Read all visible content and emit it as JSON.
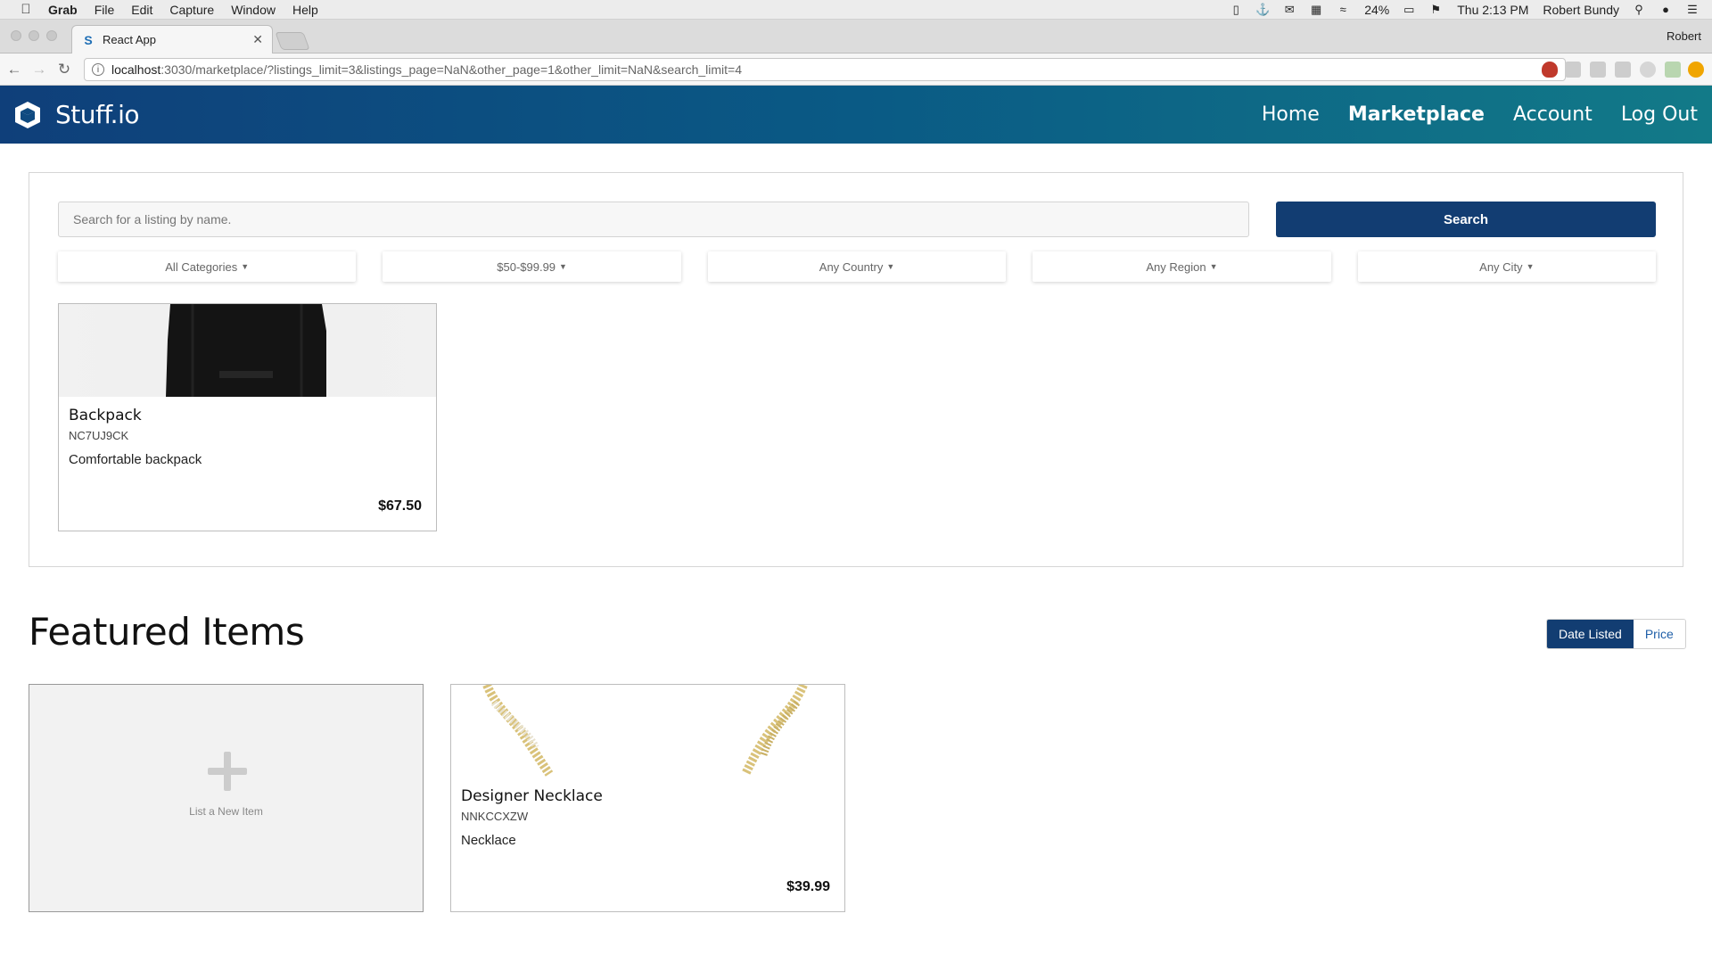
{
  "menubar": {
    "app": "Grab",
    "items": [
      "File",
      "Edit",
      "Capture",
      "Window",
      "Help"
    ],
    "battery": "24%",
    "clock": "Thu 2:13 PM",
    "user": "Robert Bundy"
  },
  "browser": {
    "tab_title": "React App",
    "profile": "Robert",
    "url_host": "localhost",
    "url_path": ":3030/marketplace/?listings_limit=3&listings_page=NaN&other_page=1&other_limit=NaN&search_limit=4"
  },
  "app_nav": {
    "brand": "Stuff.io",
    "links": [
      "Home",
      "Marketplace",
      "Account",
      "Log Out"
    ],
    "active": "Marketplace"
  },
  "search": {
    "placeholder": "Search for a listing by name.",
    "button": "Search",
    "filters": [
      "All Categories",
      "$50-$99.99",
      "Any Country",
      "Any Region",
      "Any City"
    ]
  },
  "search_results": [
    {
      "title": "Backpack",
      "code": "NC7UJ9CK",
      "description": "Comfortable backpack",
      "price": "$67.50"
    }
  ],
  "featured": {
    "title": "Featured Items",
    "sort": {
      "active": "Date Listed",
      "inactive": "Price"
    },
    "new_item_label": "List a New Item",
    "items": [
      {
        "title": "Designer Necklace",
        "code": "NNKCCXZW",
        "description": "Necklace",
        "price": "$39.99"
      }
    ]
  },
  "colors": {
    "primary": "#123d72",
    "nav_gradient_start": "#0f3f7a",
    "nav_gradient_end": "#127a88"
  }
}
